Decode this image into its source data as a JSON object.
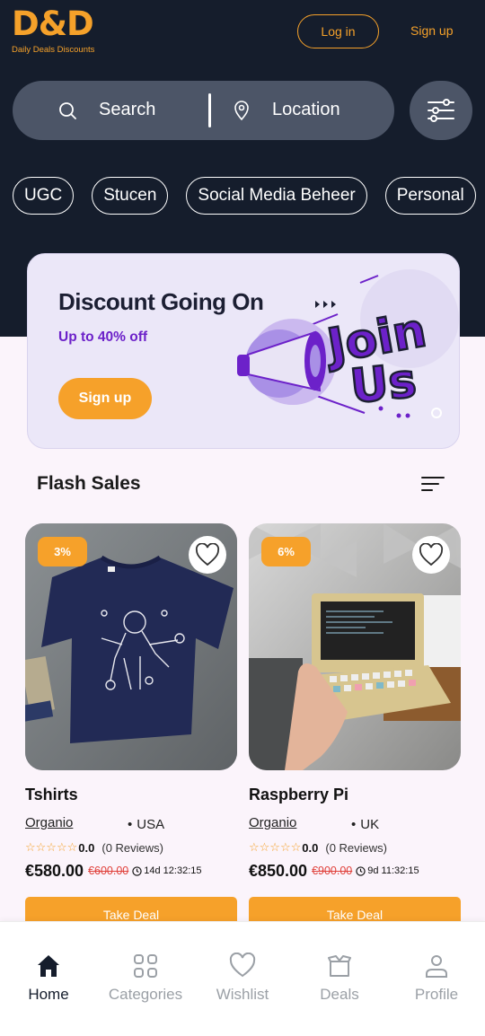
{
  "brand": {
    "logo": "D&D",
    "tagline": "Daily Deals Discounts",
    "accent": "#f5a12a",
    "dark": "#151d2c"
  },
  "header": {
    "login_label": "Log in",
    "signup_label": "Sign up"
  },
  "search": {
    "placeholder": "Search",
    "location_placeholder": "Location",
    "search_icon": "search-icon",
    "location_icon": "location-pin-icon",
    "filter_icon": "filter-sliders-icon"
  },
  "categories": [
    "UGC",
    "Stucen",
    "Social Media Beheer",
    "Personal"
  ],
  "banner": {
    "title": "Discount Going On",
    "subtitle": "Up to 40% off",
    "button_label": "Sign up",
    "art_text_line1": "Join",
    "art_text_line2": "Us"
  },
  "flash_sales": {
    "title": "Flash Sales",
    "products": [
      {
        "badge": "3%",
        "title": "Tshirts",
        "store": "Organio",
        "country": "USA",
        "stars": "☆☆☆☆☆",
        "rating": "0.0",
        "reviews": "(0 Reviews)",
        "price": "€580.00",
        "old_price": "€600.00",
        "timer": "14d 12:32:15",
        "button_label": "Take Deal"
      },
      {
        "badge": "6%",
        "title": "Raspberry Pi",
        "store": "Organio",
        "country": "UK",
        "stars": "☆☆☆☆☆",
        "rating": "0.0",
        "reviews": "(0 Reviews)",
        "price": "€850.00",
        "old_price": "€900.00",
        "timer": "9d 11:32:15",
        "button_label": "Take Deal"
      }
    ]
  },
  "bottom_nav": [
    {
      "label": "Home",
      "icon": "home-icon",
      "active": true
    },
    {
      "label": "Categories",
      "icon": "grid-icon",
      "active": false
    },
    {
      "label": "Wishlist",
      "icon": "heart-icon",
      "active": false
    },
    {
      "label": "Deals",
      "icon": "box-icon",
      "active": false
    },
    {
      "label": "Profile",
      "icon": "user-icon",
      "active": false
    }
  ]
}
